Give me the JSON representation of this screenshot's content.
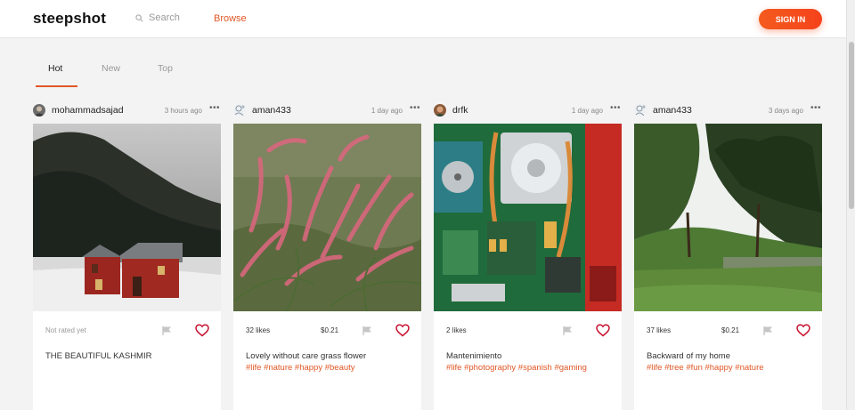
{
  "header": {
    "logo": "steepshot",
    "search_placeholder": "Search",
    "browse_label": "Browse",
    "signin_label": "SIGN IN"
  },
  "tabs": [
    {
      "label": "Hot",
      "active": true
    },
    {
      "label": "New",
      "active": false
    },
    {
      "label": "Top",
      "active": false
    }
  ],
  "posts": [
    {
      "username": "mohammadsajad",
      "time": "3 hours ago",
      "likes": "Not rated yet",
      "payout": "",
      "caption": "THE BEAUTIFUL KASHMIR",
      "tags": "",
      "image": "snowy-mountain-red-cabins"
    },
    {
      "username": "aman433",
      "time": "1 day ago",
      "likes": "32 likes",
      "payout": "$0.21",
      "caption": "Lovely without care grass flower",
      "tags": "#life #nature #happy #beauty",
      "image": "pink-grass-flowers"
    },
    {
      "username": "drfk",
      "time": "1 day ago",
      "likes": "2 likes",
      "payout": "",
      "caption": "Mantenimiento",
      "tags": "#life #photography #spanish #gaming",
      "image": "laptop-motherboard"
    },
    {
      "username": "aman433",
      "time": "3 days ago",
      "likes": "37 likes",
      "payout": "$0.21",
      "caption": "Backward of my home",
      "tags": "#life #tree #fun #happy #nature",
      "image": "green-trees-yard"
    }
  ],
  "colors": {
    "accent": "#e05726",
    "signin": "#f5421b",
    "heart": "#c8102e"
  },
  "icons": [
    "search-icon",
    "more-icon",
    "flag-icon",
    "heart-icon"
  ]
}
